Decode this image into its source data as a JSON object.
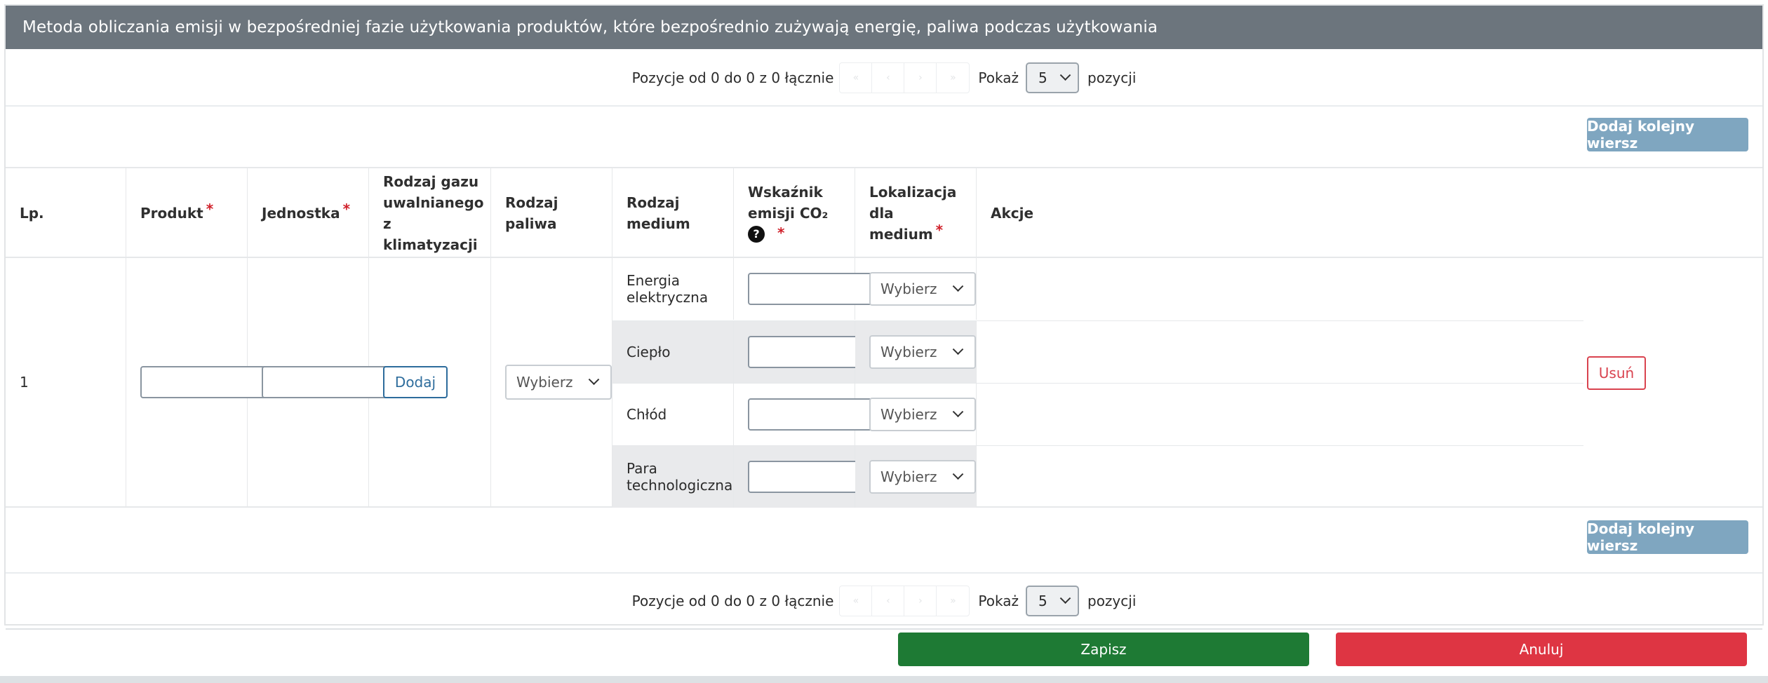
{
  "header": {
    "title": "Metoda obliczania emisji w bezpośredniej fazie użytkowania produktów, które bezpośrednio zużywają energię, paliwa podczas użytkowania"
  },
  "pager": {
    "info": "Pozycje od 0 do 0 z 0 łącznie",
    "nav": [
      "«",
      "‹",
      "›",
      "»"
    ],
    "show_label": "Pokaż",
    "page_size": "5",
    "suffix": "pozycji"
  },
  "add_row_label": "Dodaj kolejny wiersz",
  "required_mark": "*",
  "columns": {
    "lp": "Lp.",
    "produkt": "Produkt",
    "jednostka": "Jednostka",
    "gaz": "Rodzaj gazu uwalnianego z klimatyzacji",
    "paliwo": "Rodzaj paliwa",
    "medium": "Rodzaj medium",
    "wskaznik": "Wskaźnik emisji CO₂",
    "wskaznik_info": "?",
    "lokalizacja": "Lokalizacja dla medium",
    "akcje": "Akcje"
  },
  "row": {
    "lp": "1",
    "produkt_value": "",
    "jednostka_value": "",
    "dodaj_label": "Dodaj",
    "paliwo_select": "Wybierz",
    "usun_label": "Usuń",
    "media": [
      {
        "name": "Energia elektryczna",
        "wskaznik": "",
        "lokalizacja": "Wybierz"
      },
      {
        "name": "Ciepło",
        "wskaznik": "",
        "lokalizacja": "Wybierz"
      },
      {
        "name": "Chłód",
        "wskaznik": "",
        "lokalizacja": "Wybierz"
      },
      {
        "name": "Para technologiczna",
        "wskaznik": "",
        "lokalizacja": "Wybierz"
      }
    ]
  },
  "footer": {
    "save_label": "Zapisz",
    "cancel_label": "Anuluj"
  },
  "colors": {
    "header_bg": "#6c757d",
    "save": "#1e7a34",
    "cancel": "#de3543",
    "add_row": "#7fa6c0",
    "required": "#d0202a"
  }
}
